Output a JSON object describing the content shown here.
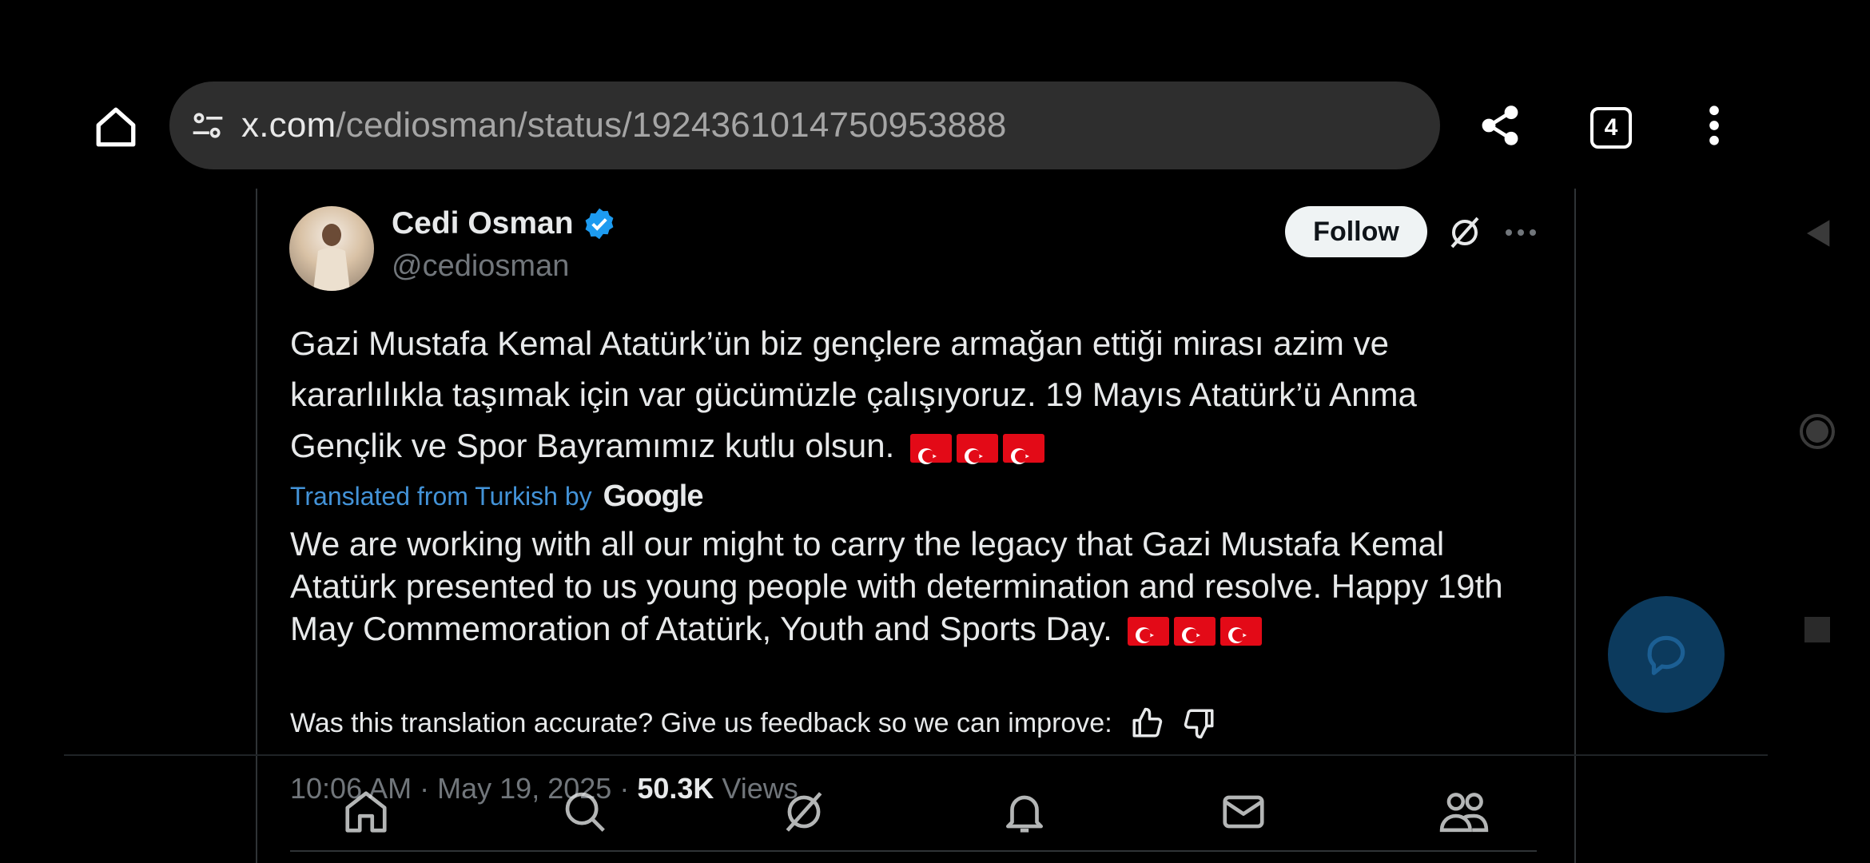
{
  "browser": {
    "url_domain": "x.com",
    "url_path": "/cediosman/status/1924361014750953888",
    "tab_count": "4",
    "icons": [
      "home-icon",
      "site-settings-icon",
      "share-icon",
      "tabs-icon",
      "more-vert-icon"
    ]
  },
  "tweet": {
    "display_name": "Cedi Osman",
    "handle": "@cediosman",
    "follow_label": "Follow",
    "text": "Gazi Mustafa Kemal Atatürk’ün biz gençlere armağan ettiği mirası azim ve kararlılıkla taşımak için var gücümüzle çalışıyoruz. 19 Mayıs Atatürk’ü Anma Gençlik ve Spor Bayramımız kutlu olsun.",
    "translated_label": "Translated from Turkish by",
    "translator_logo": "Google",
    "translation": "We are working with all our might to carry the legacy that Gazi Mustafa Kemal Atatürk presented to us young people with determination and resolve. Happy 19th May Commemoration of Atatürk, Youth and Sports Day.",
    "feedback_prompt": "Was this translation accurate? Give us feedback so we can improve:",
    "time": "10:06 AM",
    "date": "May 19, 2025",
    "views_count": "50.3K",
    "views_label": "Views",
    "separator": "·"
  },
  "colors": {
    "background": "#000000",
    "text": "#e7e9ea",
    "muted": "#71767b",
    "link": "#4393d8",
    "verified": "#1d9bf0",
    "flag_red": "#e30a17"
  },
  "bottom_nav": [
    "home-icon",
    "search-icon",
    "grok-icon",
    "notifications-icon",
    "messages-icon",
    "communities-icon"
  ]
}
